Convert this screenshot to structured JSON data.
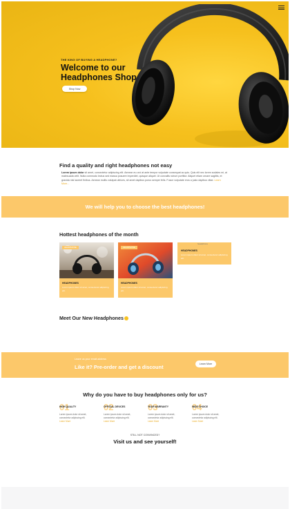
{
  "hero": {
    "kicker": "THE KING OF BUYING A HEADPHONE?",
    "title_line1": "Welcome to our",
    "title_line2": "Headphones Shop",
    "button": "Shop Now"
  },
  "intro": {
    "title": "Find a quality and right headphones not easy",
    "lead": "Lorem ipsum dolor",
    "text": " sit amet, consectetur adipiscing elit. Aenean eu orci at ante tempor vulputate consequat ac quis. Quis elit nec lorem sodales mi, at malesuada velit. Nulla commodo lectus sed massa posuere imperdiet, quisque aliquet. Ut convallis rutrum porttitor. Aliquet etiam ornare sagittis, et gravida nisi laoreet finibus. Aenean mollis volutpat ultrices, sit amet dapibus purus semper felis. Fusce vulputate eros a justo dapibus vitae.",
    "more": "Learn More..."
  },
  "band1": {
    "text": "We will help you to choose the best headphones!"
  },
  "hottest": {
    "title": "Hottest headphones of the month",
    "cards": [
      {
        "tag": "HEADPHONE",
        "name": "HEADPHONES",
        "desc": "Lorem ipsum dolor sit amet, consectetur adipiscing elit."
      },
      {
        "tag": "HEADPHONE",
        "name": "HEADPHONES",
        "desc": "Lorem ipsum dolor sit amet, consectetur adipiscing elit."
      },
      {
        "broken": "headphone",
        "name": "HEADPHONES",
        "desc": "Lorem ipsum dolor sit amet, consectetur adipiscing elit."
      }
    ]
  },
  "new": {
    "title": "Meet Our New Headphones"
  },
  "band2": {
    "sub": "Leave us your email address",
    "text": "Like it? Pre-order and get a discount",
    "button": "Learn More"
  },
  "why": {
    "title": "Why do you have to buy headphones only for us?",
    "features": [
      {
        "num": "01",
        "label": "HIGH QUALITY",
        "desc": "Lorem ipsum dolor sit amet, consectetur adipiscing elit.",
        "more": "Learn More"
      },
      {
        "num": "02",
        "label": "OFFICIAL DEVICES",
        "desc": "Lorem ipsum dolor sit amet, consectetur adipiscing elit.",
        "more": "Learn More"
      },
      {
        "num": "03",
        "label": "YEAR WARRANTY",
        "desc": "Lorem ipsum dolor sit amet, consectetur adipiscing elit.",
        "more": "Learn More"
      },
      {
        "num": "04",
        "label": "WIDE CHOICE",
        "desc": "Lorem ipsum dolor sit amet, consectetur adipiscing elit.",
        "more": "Learn More"
      }
    ]
  },
  "visit": {
    "sub": "STILL NOT CONVINCED?",
    "title": "Visit us and see yourself!"
  },
  "colors": {
    "accent": "#f7c221",
    "band": "#fcc86a",
    "link": "#e9a91c"
  },
  "icons": [
    "menu-icon",
    "headphones-image"
  ]
}
